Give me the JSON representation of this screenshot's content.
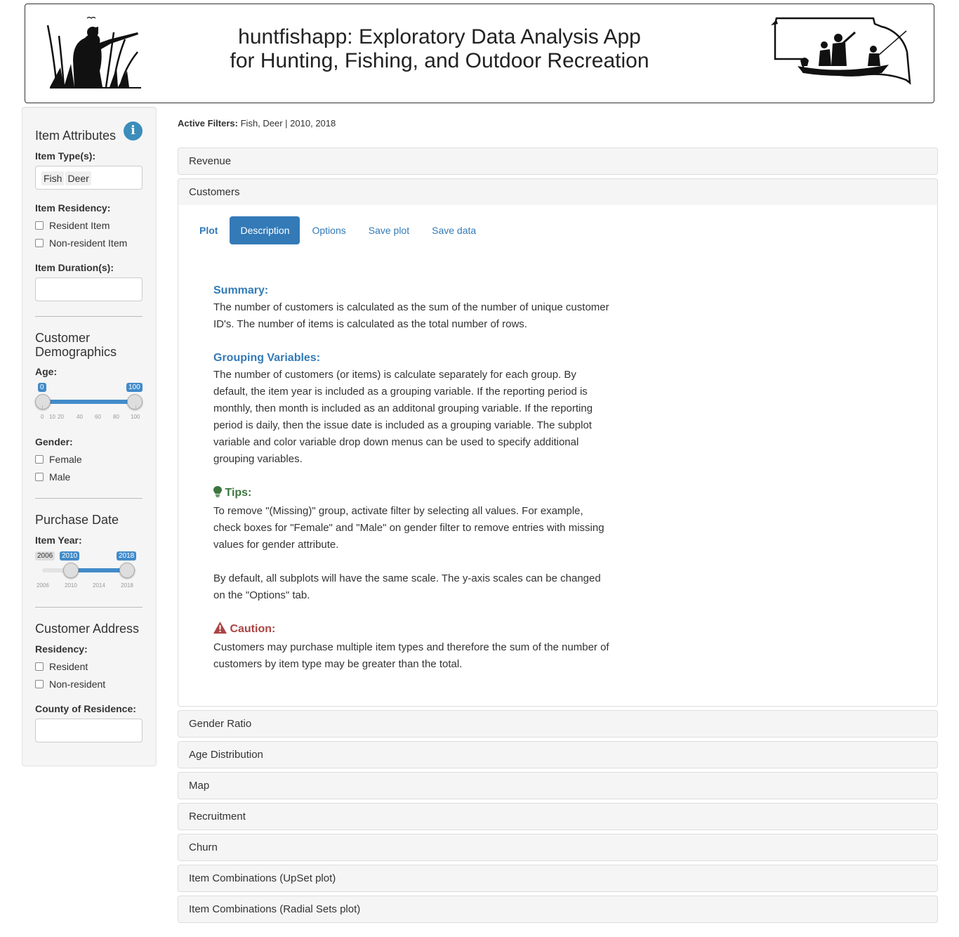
{
  "header": {
    "title_line1": "huntfishapp: Exploratory Data Analysis App",
    "title_line2": "for Hunting, Fishing, and Outdoor Recreation"
  },
  "sidebar": {
    "item_attributes": {
      "heading": "Item Attributes",
      "item_types_label": "Item Type(s):",
      "item_types": [
        "Fish",
        "Deer"
      ],
      "residency_label": "Item Residency:",
      "residency_options": [
        "Resident Item",
        "Non-resident Item"
      ],
      "duration_label": "Item Duration(s):"
    },
    "demographics": {
      "heading": "Customer Demographics",
      "age_label": "Age:",
      "age_slider": {
        "min": 0,
        "max": 100,
        "low": 0,
        "high": 100,
        "low_label": "0",
        "high_label": "100",
        "tick_labels": [
          "0",
          "10",
          "20",
          "40",
          "60",
          "80",
          "100"
        ]
      },
      "gender_label": "Gender:",
      "gender_options": [
        "Female",
        "Male"
      ]
    },
    "purchase_date": {
      "heading": "Purchase Date",
      "year_label": "Item Year:",
      "year_slider": {
        "min": 2006,
        "max": 2018,
        "low": 2010,
        "high": 2018,
        "min_label": "2006",
        "low_label": "2010",
        "high_label": "2018",
        "tick_labels": [
          "2006",
          "2010",
          "2014",
          "2018"
        ]
      }
    },
    "address": {
      "heading": "Customer Address",
      "residency_label": "Residency:",
      "residency_options": [
        "Resident",
        "Non-resident"
      ],
      "county_label": "County of Residence:"
    }
  },
  "main": {
    "filters_label": "Active Filters:",
    "filters_value": "Fish, Deer | 2010, 2018",
    "panels_top": [
      "Revenue",
      "Customers"
    ],
    "tabs": [
      "Plot",
      "Description",
      "Options",
      "Save plot",
      "Save data"
    ],
    "active_tab": "Description",
    "description": {
      "summary_heading": "Summary:",
      "summary_text": "The number of customers is calculated as the sum of the number of unique customer ID's. The number of items is calculated as the total number of rows.",
      "grouping_heading": "Grouping Variables:",
      "grouping_text": "The number of customers (or items) is calculate separately for each group. By default, the item year is included as a grouping variable. If the reporting period is monthly, then month is included as an additonal grouping variable. If the reporting period is daily, then the issue date is included as a grouping variable. The subplot variable and color variable drop down menus can be used to specify additional grouping variables.",
      "tips_heading": "Tips:",
      "tips_text1": "To remove \"(Missing)\" group, activate filter by selecting all values. For example, check boxes for \"Female\" and \"Male\" on gender filter to remove entries with missing values for gender attribute.",
      "tips_text2": "By default, all subplots will have the same scale. The y-axis scales can be changed on the \"Options\" tab.",
      "caution_heading": "Caution:",
      "caution_text": "Customers may purchase multiple item types and therefore the sum of the number of customers by item type may be greater than the total."
    },
    "panels_bottom": [
      "Gender Ratio",
      "Age Distribution",
      "Map",
      "Recruitment",
      "Churn",
      "Item Combinations (UpSet plot)",
      "Item Combinations (Radial Sets plot)"
    ]
  },
  "icons": {
    "info": "info-circle-icon",
    "tips": "lightbulb-icon",
    "caution": "warning-triangle-icon",
    "left_logo": "hunter-silhouette-icon",
    "right_logo": "nebraska-boat-fishing-icon"
  },
  "colors": {
    "accent": "#337ab7",
    "tips_green": "#3c763d",
    "caution_red": "#a94442"
  }
}
